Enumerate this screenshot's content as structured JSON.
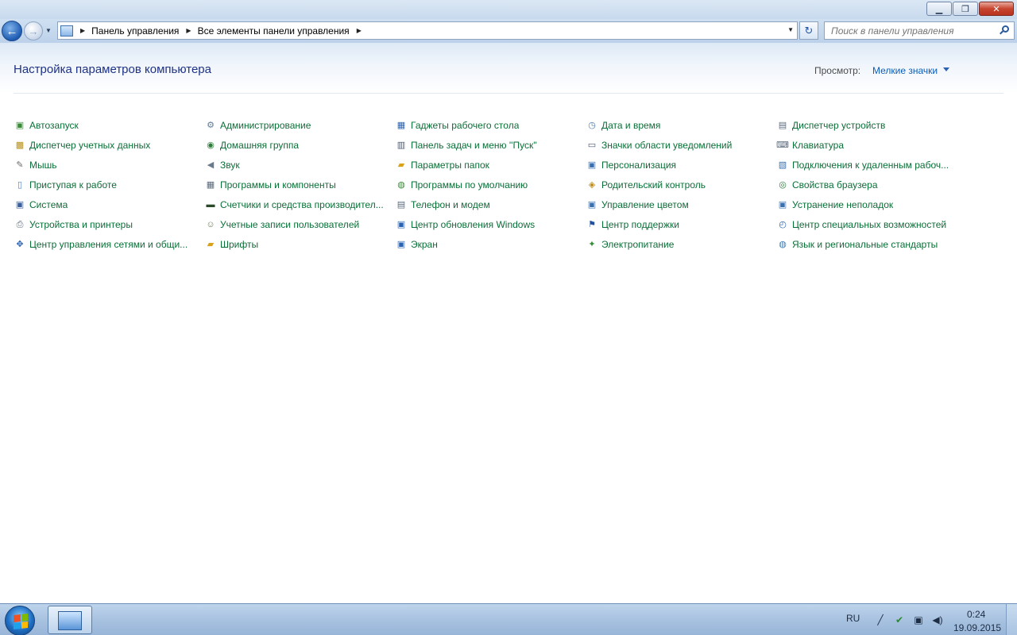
{
  "window": {
    "controls": {
      "minimize": "▁",
      "maximize": "❐",
      "close": "✕"
    }
  },
  "nav": {
    "back_glyph": "←",
    "forward_glyph": "→",
    "breadcrumbs": [
      "Панель управления",
      "Все элементы панели управления"
    ],
    "search_placeholder": "Поиск в панели управления"
  },
  "header": {
    "title": "Настройка параметров компьютера",
    "view_label": "Просмотр:",
    "view_value": "Мелкие значки"
  },
  "items": [
    {
      "label": "Автозапуск",
      "icon": "autoplay-icon",
      "glyph": "▣",
      "color": "#3a8a3a"
    },
    {
      "label": "Администрирование",
      "icon": "admin-tools-icon",
      "glyph": "⚙",
      "color": "#5d7a98"
    },
    {
      "label": "Гаджеты рабочего стола",
      "icon": "gadgets-icon",
      "glyph": "▦",
      "color": "#2a63b1"
    },
    {
      "label": "Дата и время",
      "icon": "clock-icon",
      "glyph": "◷",
      "color": "#4e7bb0"
    },
    {
      "label": "Диспетчер устройств",
      "icon": "device-manager-icon",
      "glyph": "▤",
      "color": "#5a6a7e"
    },
    {
      "label": "Диспетчер учетных данных",
      "icon": "credential-icon",
      "glyph": "▩",
      "color": "#b8921e"
    },
    {
      "label": "Домашняя группа",
      "icon": "homegroup-icon",
      "glyph": "◉",
      "color": "#2f7d3c"
    },
    {
      "label": "Панель задач и меню ''Пуск''",
      "icon": "taskbar-icon",
      "glyph": "▥",
      "color": "#4a5a70"
    },
    {
      "label": "Значки области уведомлений",
      "icon": "notification-icon",
      "glyph": "▭",
      "color": "#4a5a70"
    },
    {
      "label": "Клавиатура",
      "icon": "keyboard-icon",
      "glyph": "⌨",
      "color": "#5a6a7e"
    },
    {
      "label": "Мышь",
      "icon": "mouse-icon",
      "glyph": "✎",
      "color": "#6a6a6a"
    },
    {
      "label": "Звук",
      "icon": "sound-icon",
      "glyph": "◀",
      "color": "#6a7a8a"
    },
    {
      "label": "Параметры папок",
      "icon": "folder-options-icon",
      "glyph": "▰",
      "color": "#d9a21b"
    },
    {
      "label": "Персонализация",
      "icon": "personalization-icon",
      "glyph": "▣",
      "color": "#3a6fb0"
    },
    {
      "label": "Подключения к удаленным рабоч...",
      "icon": "remoteapp-icon",
      "glyph": "▧",
      "color": "#3a6fb0"
    },
    {
      "label": "Приступая к работе",
      "icon": "getting-started-icon",
      "glyph": "▯",
      "color": "#4a7fc0"
    },
    {
      "label": "Программы и компоненты",
      "icon": "programs-icon",
      "glyph": "▦",
      "color": "#5a6a7e"
    },
    {
      "label": "Программы по умолчанию",
      "icon": "default-programs-icon",
      "glyph": "◍",
      "color": "#3a8a3a"
    },
    {
      "label": "Родительский контроль",
      "icon": "parental-controls-icon",
      "glyph": "◈",
      "color": "#c08a1a"
    },
    {
      "label": "Свойства браузера",
      "icon": "internet-options-icon",
      "glyph": "◎",
      "color": "#2a7a3a"
    },
    {
      "label": "Система",
      "icon": "system-icon",
      "glyph": "▣",
      "color": "#3a5f9a"
    },
    {
      "label": "Счетчики и средства производител...",
      "icon": "performance-icon",
      "glyph": "▬",
      "color": "#2a4a2a"
    },
    {
      "label": "Телефон и модем",
      "icon": "phone-modem-icon",
      "glyph": "▤",
      "color": "#5a6a7e"
    },
    {
      "label": "Управление цветом",
      "icon": "color-management-icon",
      "glyph": "▣",
      "color": "#3a6fb0"
    },
    {
      "label": "Устранение неполадок",
      "icon": "troubleshooting-icon",
      "glyph": "▣",
      "color": "#3a6fb0"
    },
    {
      "label": "Устройства и принтеры",
      "icon": "printer-icon",
      "glyph": "⎙",
      "color": "#5a6a7e"
    },
    {
      "label": "Учетные записи пользователей",
      "icon": "user-accounts-icon",
      "glyph": "☺",
      "color": "#6a7a5a"
    },
    {
      "label": "Центр обновления Windows",
      "icon": "windows-update-icon",
      "glyph": "▣",
      "color": "#2a63b1"
    },
    {
      "label": "Центр поддержки",
      "icon": "action-center-icon",
      "glyph": "⚑",
      "color": "#1e4fa3"
    },
    {
      "label": "Центр специальных возможностей",
      "icon": "ease-of-access-icon",
      "glyph": "◴",
      "color": "#2a63b1"
    },
    {
      "label": "Центр управления сетями и общи...",
      "icon": "network-center-icon",
      "glyph": "✥",
      "color": "#2a63b1"
    },
    {
      "label": "Шрифты",
      "icon": "fonts-icon",
      "glyph": "▰",
      "color": "#d9a21b"
    },
    {
      "label": "Экран",
      "icon": "display-icon",
      "glyph": "▣",
      "color": "#2a63b1"
    },
    {
      "label": "Электропитание",
      "icon": "power-options-icon",
      "glyph": "✦",
      "color": "#3a8a3a"
    },
    {
      "label": "Язык и региональные стандарты",
      "icon": "region-language-icon",
      "glyph": "◍",
      "color": "#3a7ab0"
    }
  ],
  "taskbar": {
    "language": "RU",
    "time": "0:24",
    "date": "19.09.2015",
    "tray_glyphs": {
      "pen": "╱",
      "security": "✔",
      "network": "▣",
      "volume": "◀)"
    }
  }
}
